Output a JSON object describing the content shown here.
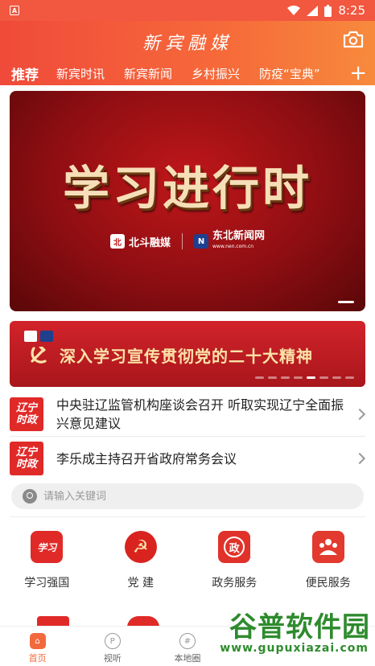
{
  "status_bar": {
    "time": "8:25"
  },
  "header": {
    "app_title": "新宾融媒"
  },
  "tabs": [
    {
      "label": "推荐",
      "active": true
    },
    {
      "label": "新宾时讯",
      "active": false
    },
    {
      "label": "新宾新闻",
      "active": false
    },
    {
      "label": "乡村振兴",
      "active": false
    },
    {
      "label": "防疫“宝典”",
      "active": false
    }
  ],
  "hero": {
    "title": "学习进行时",
    "logo_left": "北斗融媒",
    "logo_right": "东北新闻网",
    "logo_right_url": "www.nen.com.cn"
  },
  "banner2": {
    "text": "深入学习宣传贯彻党的二十大精神"
  },
  "news": [
    {
      "logo_line1": "辽宁",
      "logo_line2": "时政",
      "title": "中央驻辽监管机构座谈会召开 听取实现辽宁全面振兴意见建议"
    },
    {
      "logo_line1": "辽宁",
      "logo_line2": "时政",
      "title": "李乐成主持召开省政府常务会议"
    }
  ],
  "search": {
    "placeholder": "请输入关键词"
  },
  "services": [
    {
      "label": "学习强国",
      "icon": "xuexi-icon",
      "color": "#e02a28",
      "glyph": "学习"
    },
    {
      "label": "党 建",
      "icon": "party-emblem-icon",
      "color": "#d9231f",
      "glyph": "☭"
    },
    {
      "label": "政务服务",
      "icon": "government-icon",
      "color": "#e0322a",
      "glyph": "政"
    },
    {
      "label": "便民服务",
      "icon": "people-service-icon",
      "color": "#e23a2e",
      "glyph": "民"
    }
  ],
  "bottom_nav": [
    {
      "label": "首页",
      "icon": "home-icon",
      "active": true
    },
    {
      "label": "视听",
      "icon": "play-icon",
      "active": false
    },
    {
      "label": "本地圈",
      "icon": "hashtag-icon",
      "active": false
    },
    {
      "label": "",
      "icon": "",
      "active": false
    },
    {
      "label": "",
      "icon": "",
      "active": false
    }
  ],
  "watermark": {
    "main": "谷普软件园",
    "sub": "www.gupuxiazai.com"
  }
}
